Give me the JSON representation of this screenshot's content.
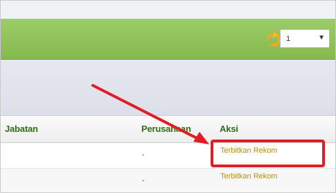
{
  "toolbar": {
    "page_select_value": "1",
    "refresh_icon": "refresh-icon",
    "dropdown_icon": "caret-down-icon"
  },
  "table": {
    "headers": {
      "jabatan": "Jabatan",
      "perusahaan": "Perusahaan",
      "aksi": "Aksi"
    },
    "rows": [
      {
        "perusahaan": "-",
        "aksi": "Terbitkan Rekom"
      },
      {
        "perusahaan": "-",
        "aksi": "Terbitkan Rekom"
      }
    ]
  },
  "annotation": {
    "arrow_color": "#e31b23",
    "highlight_color": "#e31b23"
  },
  "colors": {
    "toolbar_green": "#8fc159",
    "header_text": "#2f6e14",
    "action_link": "#c08a18"
  }
}
